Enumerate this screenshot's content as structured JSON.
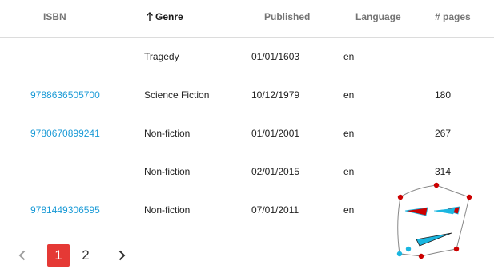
{
  "table": {
    "headers": {
      "isbn": "ISBN",
      "genre": "Genre",
      "published": "Published",
      "language": "Language",
      "pages": "# pages"
    },
    "sort": {
      "column": "genre",
      "direction": "ascending"
    },
    "rows": [
      {
        "isbn": "",
        "genre": "Tragedy",
        "published": "01/01/1603",
        "language": "en",
        "pages": ""
      },
      {
        "isbn": "9788636505700",
        "genre": "Science Fiction",
        "published": "10/12/1979",
        "language": "en",
        "pages": "180"
      },
      {
        "isbn": "9780670899241",
        "genre": "Non-fiction",
        "published": "01/01/2001",
        "language": "en",
        "pages": "267"
      },
      {
        "isbn": "",
        "genre": "Non-fiction",
        "published": "02/01/2015",
        "language": "en",
        "pages": "314"
      },
      {
        "isbn": "9781449306595",
        "genre": "Non-fiction",
        "published": "07/01/2011",
        "language": "en",
        "pages": ""
      }
    ]
  },
  "pagination": {
    "pages": [
      "1",
      "2"
    ],
    "current": "1"
  },
  "colors": {
    "link": "#1a9ad6",
    "active_page": "#e53935",
    "header_text": "#757575",
    "widget_red": "#cc0000",
    "widget_cyan": "#1ab6e0"
  },
  "icons": {
    "sort": "arrow-up-icon",
    "prev": "chevron-left-icon",
    "next": "chevron-right-icon",
    "widget": "transform-handles-icon"
  }
}
